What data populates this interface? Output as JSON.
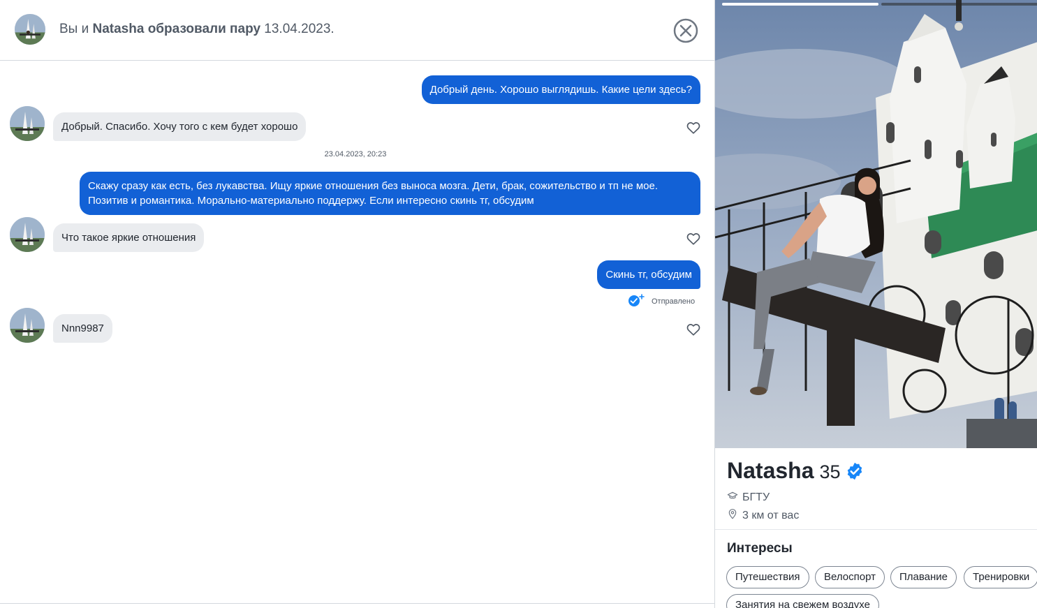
{
  "header": {
    "title_prefix": "Вы и ",
    "match_name": "Natasha",
    "title_middle": " образовали пару ",
    "match_date": "13.04.2023.",
    "close_icon": "close-circle-icon"
  },
  "messages": [
    {
      "direction": "outgoing",
      "text": "Добрый день. Хорошо выглядишь. Какие цели здесь?"
    },
    {
      "direction": "incoming",
      "text": "Добрый. Спасибо. Хочу того с кем будет хорошо",
      "like_icon": "heart-outline-icon"
    },
    {
      "direction": "timestamp",
      "text": "23.04.2023, 20:23"
    },
    {
      "direction": "outgoing",
      "text_line1": "Скажу сразу как есть, без лукавства. Ищу яркие отношения без выноса мозга. Дети, брак, сожительство и тп не мое.",
      "text_line2": "Позитив и романтика. Морально-материально поддержу. Если интересно скинь тг, обсудим"
    },
    {
      "direction": "incoming",
      "text": "Что такое яркие отношения",
      "like_icon": "heart-outline-icon"
    },
    {
      "direction": "outgoing",
      "text": "Скинь тг, обсудим",
      "status": "Отправлено",
      "status_icon": "sent-check-icon"
    },
    {
      "direction": "incoming",
      "text": "Nnn9987",
      "like_icon": "heart-outline-icon"
    }
  ],
  "profile": {
    "name": "Natasha",
    "age": "35",
    "verified_icon": "verified-badge-icon",
    "education": "БГТУ",
    "education_icon": "graduation-cap-icon",
    "distance": "3 км от вас",
    "distance_icon": "location-pin-icon",
    "photo_count": 2,
    "active_photo": 1,
    "interests_title": "Интересы",
    "interests": [
      "Путешествия",
      "Велоспорт",
      "Плавание",
      "Тренировки",
      "Занятия на свежем воздухе"
    ]
  },
  "colors": {
    "outgoing_bubble": "#1261d6",
    "incoming_bubble": "#eaecef",
    "verified": "#1786f8",
    "text_primary": "#21262e",
    "text_secondary": "#505965"
  }
}
